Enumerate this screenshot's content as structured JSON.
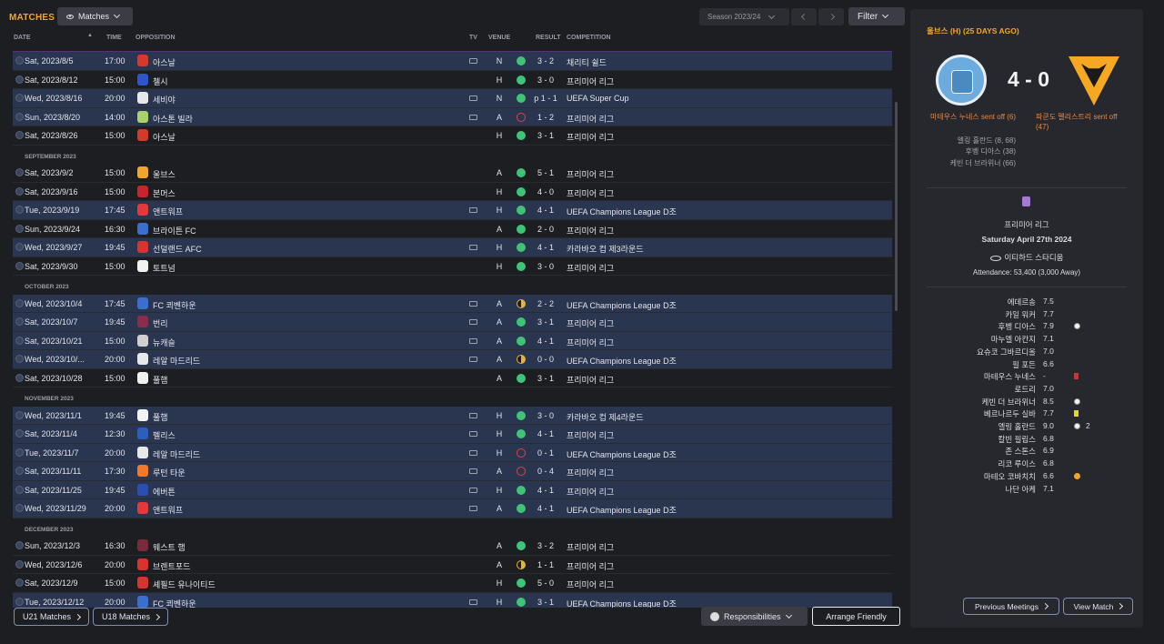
{
  "header": {
    "title": "MATCHES",
    "view_label": "Matches",
    "season_label": "Season 2023/24",
    "filter_label": "Filter"
  },
  "columns": {
    "date": "DATE",
    "time": "TIME",
    "opposition": "OPPOSITION",
    "tv": "TV",
    "venue": "VENUE",
    "result": "RESULT",
    "competition": "COMPETITION"
  },
  "rows": [
    {
      "kind": "partial"
    },
    {
      "date": "Sat, 2023/8/5",
      "time": "17:00",
      "opp": "아스날",
      "crest": "#d33a2c",
      "tv": true,
      "venue": "N",
      "outcome": "w",
      "score": "3 - 2",
      "comp": "채리티 쉴드"
    },
    {
      "date": "Sat, 2023/8/12",
      "time": "15:00",
      "opp": "첼시",
      "crest": "#2e56c9",
      "tv": false,
      "venue": "H",
      "outcome": "w",
      "score": "3 - 0",
      "comp": "프리미어 리그"
    },
    {
      "date": "Wed, 2023/8/16",
      "time": "20:00",
      "opp": "세비야",
      "crest": "#e8e8e8",
      "tv": true,
      "venue": "N",
      "outcome": "w",
      "score": "p 1 - 1",
      "comp": "UEFA Super Cup"
    },
    {
      "date": "Sun, 2023/8/20",
      "time": "14:00",
      "opp": "아스톤 빌라",
      "crest": "#a8d36a",
      "tv": true,
      "venue": "A",
      "outcome": "l",
      "score": "1 - 2",
      "comp": "프리미어 리그"
    },
    {
      "date": "Sat, 2023/8/26",
      "time": "15:00",
      "opp": "아스날",
      "crest": "#d33a2c",
      "tv": false,
      "venue": "H",
      "outcome": "w",
      "score": "3 - 1",
      "comp": "프리미어 리그"
    },
    {
      "kind": "section",
      "label": "SEPTEMBER 2023"
    },
    {
      "date": "Sat, 2023/9/2",
      "time": "15:00",
      "opp": "울브스",
      "crest": "#f0a62a",
      "tv": false,
      "venue": "A",
      "outcome": "w",
      "score": "5 - 1",
      "comp": "프리미어 리그"
    },
    {
      "date": "Sat, 2023/9/16",
      "time": "15:00",
      "opp": "본머스",
      "crest": "#c8242c",
      "tv": false,
      "venue": "H",
      "outcome": "w",
      "score": "4 - 0",
      "comp": "프리미어 리그"
    },
    {
      "date": "Tue, 2023/9/19",
      "time": "17:45",
      "opp": "앤트워프",
      "crest": "#e23a3a",
      "tv": true,
      "venue": "H",
      "outcome": "w",
      "score": "4 - 1",
      "comp": "UEFA Champions League D조"
    },
    {
      "date": "Sun, 2023/9/24",
      "time": "16:30",
      "opp": "브라이튼 FC",
      "crest": "#3a6fd0",
      "tv": false,
      "venue": "A",
      "outcome": "w",
      "score": "2 - 0",
      "comp": "프리미어 리그"
    },
    {
      "date": "Wed, 2023/9/27",
      "time": "19:45",
      "opp": "선덜랜드 AFC",
      "crest": "#d8332e",
      "tv": true,
      "venue": "H",
      "outcome": "w",
      "score": "4 - 1",
      "comp": "카라바오 컵 제3라운드"
    },
    {
      "date": "Sat, 2023/9/30",
      "time": "15:00",
      "opp": "토트넘",
      "crest": "#f2f2f2",
      "tv": false,
      "venue": "H",
      "outcome": "w",
      "score": "3 - 0",
      "comp": "프리미어 리그"
    },
    {
      "kind": "section",
      "label": "OCTOBER 2023"
    },
    {
      "date": "Wed, 2023/10/4",
      "time": "17:45",
      "opp": "FC 쾨벤하운",
      "crest": "#3a6fd0",
      "tv": true,
      "venue": "A",
      "outcome": "d",
      "score": "2 - 2",
      "comp": "UEFA Champions League D조"
    },
    {
      "date": "Sat, 2023/10/7",
      "time": "19:45",
      "opp": "번리",
      "crest": "#8b2c4a",
      "tv": true,
      "venue": "A",
      "outcome": "w",
      "score": "3 - 1",
      "comp": "프리미어 리그"
    },
    {
      "date": "Sat, 2023/10/21",
      "time": "15:00",
      "opp": "뉴캐슬",
      "crest": "#cfcfcf",
      "tv": true,
      "venue": "A",
      "outcome": "w",
      "score": "4 - 1",
      "comp": "프리미어 리그"
    },
    {
      "date": "Wed, 2023/10/...",
      "time": "20:00",
      "opp": "레알 마드리드",
      "crest": "#e8e8e8",
      "tv": true,
      "venue": "A",
      "outcome": "d",
      "score": "0 - 0",
      "comp": "UEFA Champions League D조"
    },
    {
      "date": "Sat, 2023/10/28",
      "time": "15:00",
      "opp": "풀햄",
      "crest": "#f2f2f2",
      "tv": false,
      "venue": "A",
      "outcome": "w",
      "score": "3 - 1",
      "comp": "프리미어 리그"
    },
    {
      "kind": "section",
      "label": "NOVEMBER 2023"
    },
    {
      "date": "Wed, 2023/11/1",
      "time": "19:45",
      "opp": "풀햄",
      "crest": "#f2f2f2",
      "tv": true,
      "venue": "H",
      "outcome": "w",
      "score": "3 - 0",
      "comp": "카라바오 컵 제4라운드"
    },
    {
      "date": "Sat, 2023/11/4",
      "time": "12:30",
      "opp": "펠리스",
      "crest": "#2a5fc0",
      "tv": true,
      "venue": "H",
      "outcome": "w",
      "score": "4 - 1",
      "comp": "프리미어 리그"
    },
    {
      "date": "Tue, 2023/11/7",
      "time": "20:00",
      "opp": "레알 마드리드",
      "crest": "#e8e8e8",
      "tv": true,
      "venue": "H",
      "outcome": "l",
      "score": "0 - 1",
      "comp": "UEFA Champions League D조"
    },
    {
      "date": "Sat, 2023/11/11",
      "time": "17:30",
      "opp": "루턴 타운",
      "crest": "#f07a2a",
      "tv": true,
      "venue": "A",
      "outcome": "l",
      "score": "0 - 4",
      "comp": "프리미어 리그"
    },
    {
      "date": "Sat, 2023/11/25",
      "time": "19:45",
      "opp": "에버튼",
      "crest": "#2a4fb0",
      "tv": true,
      "venue": "H",
      "outcome": "w",
      "score": "4 - 1",
      "comp": "프리미어 리그"
    },
    {
      "date": "Wed, 2023/11/29",
      "time": "20:00",
      "opp": "앤트워프",
      "crest": "#e23a3a",
      "tv": true,
      "venue": "A",
      "outcome": "w",
      "score": "4 - 1",
      "comp": "UEFA Champions League D조"
    },
    {
      "kind": "section",
      "label": "DECEMBER 2023"
    },
    {
      "date": "Sun, 2023/12/3",
      "time": "16:30",
      "opp": "웨스트 햄",
      "crest": "#7a2a3a",
      "tv": false,
      "venue": "A",
      "outcome": "w",
      "score": "3 - 2",
      "comp": "프리미어 리그"
    },
    {
      "date": "Wed, 2023/12/6",
      "time": "20:00",
      "opp": "브렌트포드",
      "crest": "#d8332e",
      "tv": false,
      "venue": "A",
      "outcome": "d",
      "score": "1 - 1",
      "comp": "프리미어 리그"
    },
    {
      "date": "Sat, 2023/12/9",
      "time": "15:00",
      "opp": "셰필드 유나이티드",
      "crest": "#d8332e",
      "tv": false,
      "venue": "H",
      "outcome": "w",
      "score": "5 - 0",
      "comp": "프리미어 리그"
    },
    {
      "date": "Tue, 2023/12/12",
      "time": "20:00",
      "opp": "FC 쾨벤하운",
      "crest": "#3a6fd0",
      "tv": true,
      "venue": "H",
      "outcome": "w",
      "score": "3 - 1",
      "comp": "UEFA Champions League D조"
    }
  ],
  "footer": {
    "u21": "U21 Matches",
    "u18": "U18 Matches",
    "responsibilities": "Responsibilities",
    "arrange": "Arrange Friendly"
  },
  "panel": {
    "header": "울브스 (H) (25 DAYS AGO)",
    "score": "4 - 0",
    "home_event": "마테우스 누네스 sent off (6)",
    "away_event": "파쿤도 펠리스트리 sent off (47)",
    "home_scorers": [
      "엘링 홀란드 (8, 68)",
      "후벵 디아스 (38)",
      "케빈 더 브라위너 (66)"
    ],
    "competition": "프리미어 리그",
    "date": "Saturday April 27th 2024",
    "stadium": "이티하드 스타디움",
    "attendance": "Attendance: 53,400 (3,000 Away)",
    "players": [
      {
        "name": "에데르송",
        "rating": "7.5",
        "icon": ""
      },
      {
        "name": "카일 워커",
        "rating": "7.7",
        "icon": ""
      },
      {
        "name": "후벵 디아스",
        "rating": "7.9",
        "icon": "ball"
      },
      {
        "name": "마누엘 아칸지",
        "rating": "7.1",
        "icon": ""
      },
      {
        "name": "요슈코 그바르디올",
        "rating": "7.0",
        "icon": ""
      },
      {
        "name": "필 포든",
        "rating": "6.6",
        "icon": ""
      },
      {
        "name": "마테우스 누네스",
        "rating": "-",
        "icon": "redc"
      },
      {
        "name": "로드리",
        "rating": "7.0",
        "icon": ""
      },
      {
        "name": "케빈 더 브라위너",
        "rating": "8.5",
        "icon": "ball"
      },
      {
        "name": "베르나르두 실바",
        "rating": "7.7",
        "icon": "yel"
      },
      {
        "name": "엘링 홀란드",
        "rating": "9.0",
        "icon": "ball",
        "count": "2"
      },
      {
        "name": "칼빈 필립스",
        "rating": "6.8",
        "icon": ""
      },
      {
        "name": "존 스톤스",
        "rating": "6.9",
        "icon": ""
      },
      {
        "name": "리코 루이스",
        "rating": "6.8",
        "icon": ""
      },
      {
        "name": "마테오 코바치치",
        "rating": "6.6",
        "icon": "sub"
      },
      {
        "name": "나단 아케",
        "rating": "7.1",
        "icon": ""
      }
    ],
    "prev_btn": "Previous Meetings",
    "view_btn": "View Match"
  }
}
